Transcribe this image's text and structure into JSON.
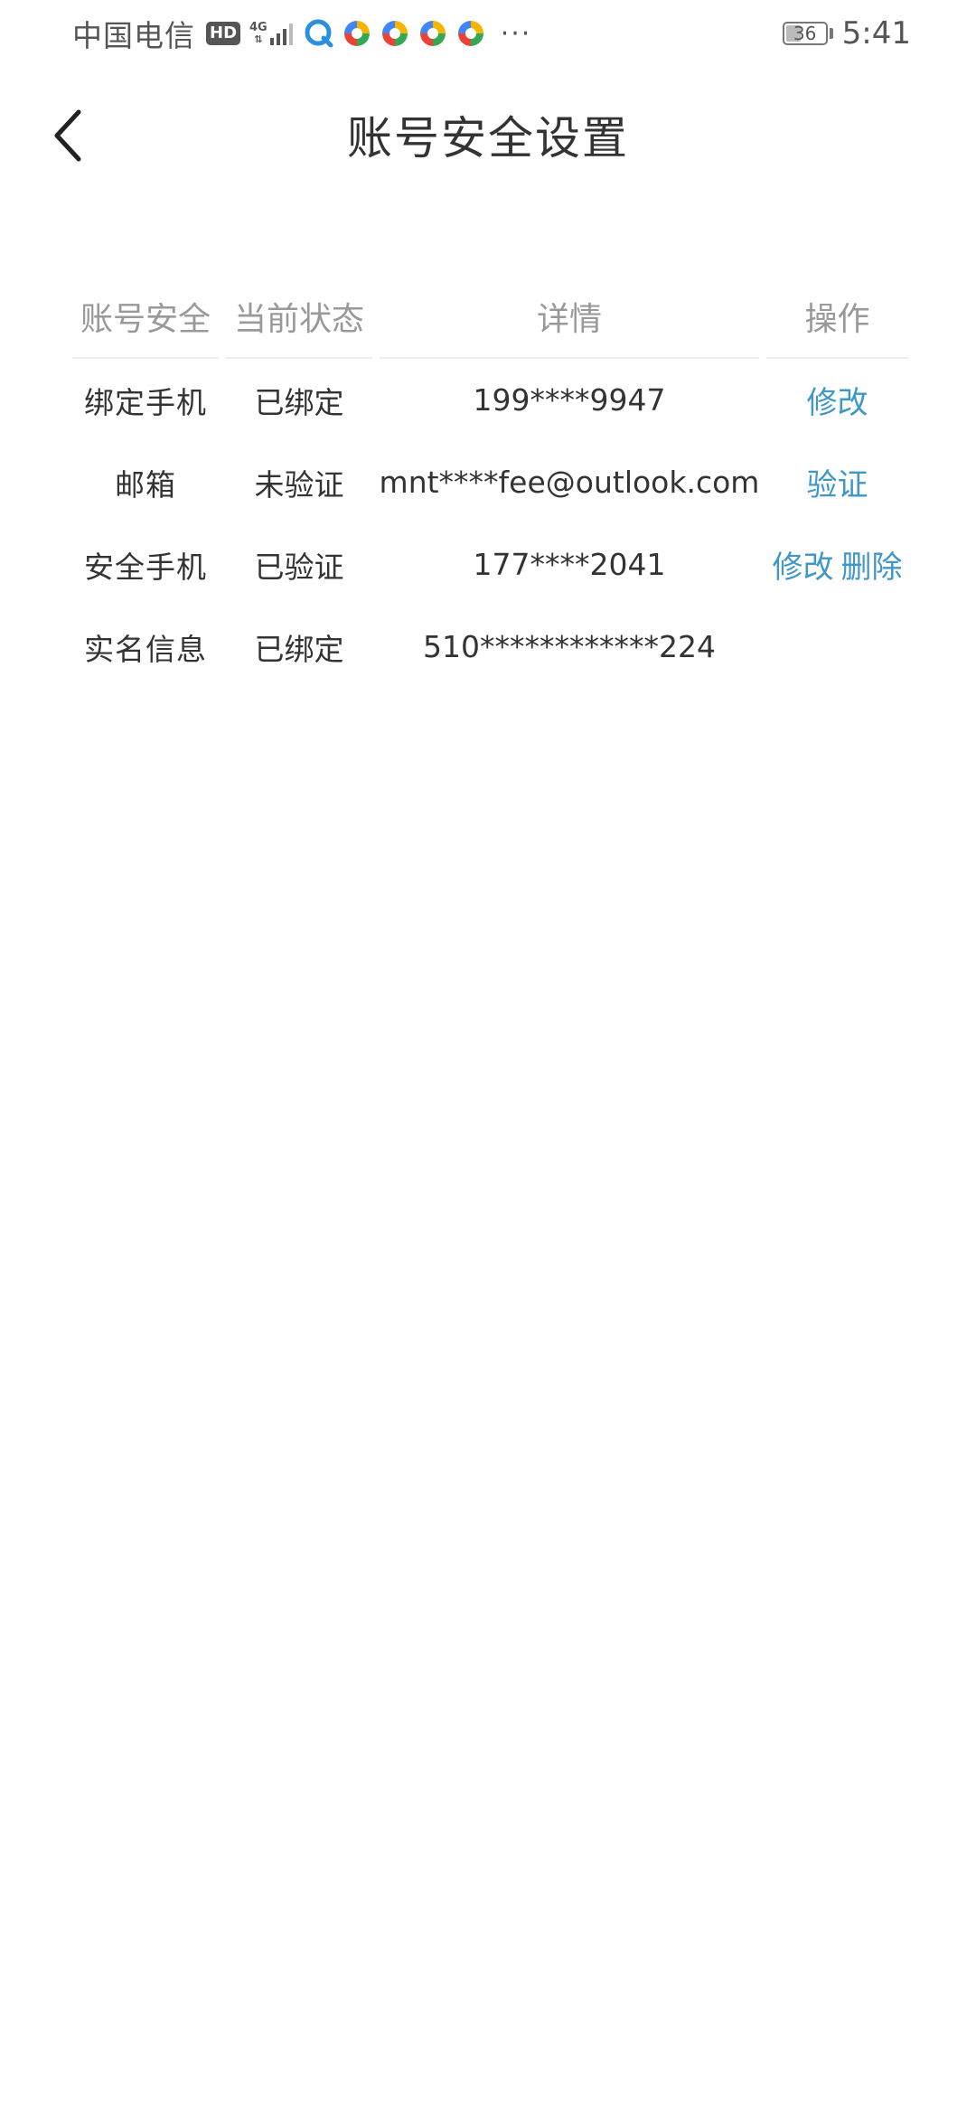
{
  "status_bar": {
    "carrier": "中国电信",
    "hd_badge": "HD",
    "network_type": "4G",
    "battery_level": "36",
    "time": "5:41",
    "more": "···"
  },
  "header": {
    "title": "账号安全设置"
  },
  "table": {
    "headers": [
      "账号安全",
      "当前状态",
      "详情",
      "操作"
    ],
    "rows": [
      {
        "item": "绑定手机",
        "status": "已绑定",
        "detail": "199****9947",
        "actions": [
          "修改"
        ]
      },
      {
        "item": "邮箱",
        "status": "未验证",
        "detail": "mnt****fee@outlook.com",
        "actions": [
          "验证"
        ]
      },
      {
        "item": "安全手机",
        "status": "已验证",
        "detail": "177****2041",
        "actions": [
          "修改",
          "删除"
        ]
      },
      {
        "item": "实名信息",
        "status": "已绑定",
        "detail": "510************224",
        "actions": []
      }
    ]
  },
  "colors": {
    "accent_link": "#3f97c6",
    "header_text": "#999999",
    "body_text": "#333333"
  }
}
